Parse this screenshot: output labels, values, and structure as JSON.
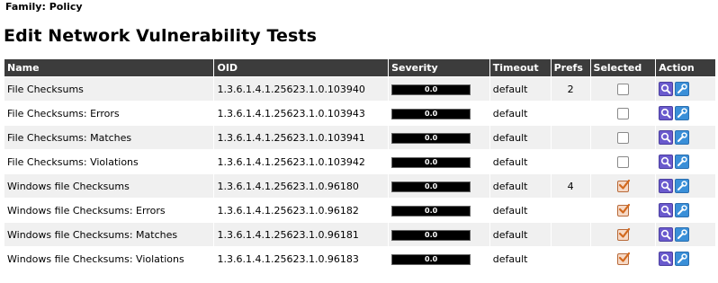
{
  "family_label": "Family: Policy",
  "page_title": "Edit Network Vulnerability Tests",
  "columns": {
    "name": "Name",
    "oid": "OID",
    "severity": "Severity",
    "timeout": "Timeout",
    "prefs": "Prefs",
    "selected": "Selected",
    "action": "Action"
  },
  "rows": [
    {
      "name": "File Checksums",
      "oid": "1.3.6.1.4.1.25623.1.0.103940",
      "severity": "0.0",
      "timeout": "default",
      "prefs": "2",
      "selected": false
    },
    {
      "name": "File Checksums: Errors",
      "oid": "1.3.6.1.4.1.25623.1.0.103943",
      "severity": "0.0",
      "timeout": "default",
      "prefs": "",
      "selected": false
    },
    {
      "name": "File Checksums: Matches",
      "oid": "1.3.6.1.4.1.25623.1.0.103941",
      "severity": "0.0",
      "timeout": "default",
      "prefs": "",
      "selected": false
    },
    {
      "name": "File Checksums: Violations",
      "oid": "1.3.6.1.4.1.25623.1.0.103942",
      "severity": "0.0",
      "timeout": "default",
      "prefs": "",
      "selected": false
    },
    {
      "name": "Windows file Checksums",
      "oid": "1.3.6.1.4.1.25623.1.0.96180",
      "severity": "0.0",
      "timeout": "default",
      "prefs": "4",
      "selected": true
    },
    {
      "name": "Windows file Checksums: Errors",
      "oid": "1.3.6.1.4.1.25623.1.0.96182",
      "severity": "0.0",
      "timeout": "default",
      "prefs": "",
      "selected": true
    },
    {
      "name": "Windows file Checksums: Matches",
      "oid": "1.3.6.1.4.1.25623.1.0.96181",
      "severity": "0.0",
      "timeout": "default",
      "prefs": "",
      "selected": true
    },
    {
      "name": "Windows file Checksums: Violations",
      "oid": "1.3.6.1.4.1.25623.1.0.96183",
      "severity": "0.0",
      "timeout": "default",
      "prefs": "",
      "selected": true
    }
  ],
  "icons": {
    "details": "magnifier-icon",
    "edit": "wrench-icon",
    "checkbox": "checkbox-icon"
  },
  "colors": {
    "header_bg": "#3c3c3c",
    "row_odd": "#f0f0f0",
    "row_even": "#ffffff",
    "severity_bar": "#000000",
    "details_icon": "#6a5acd",
    "edit_icon": "#3a8fd8",
    "checked": "#d2691e"
  }
}
